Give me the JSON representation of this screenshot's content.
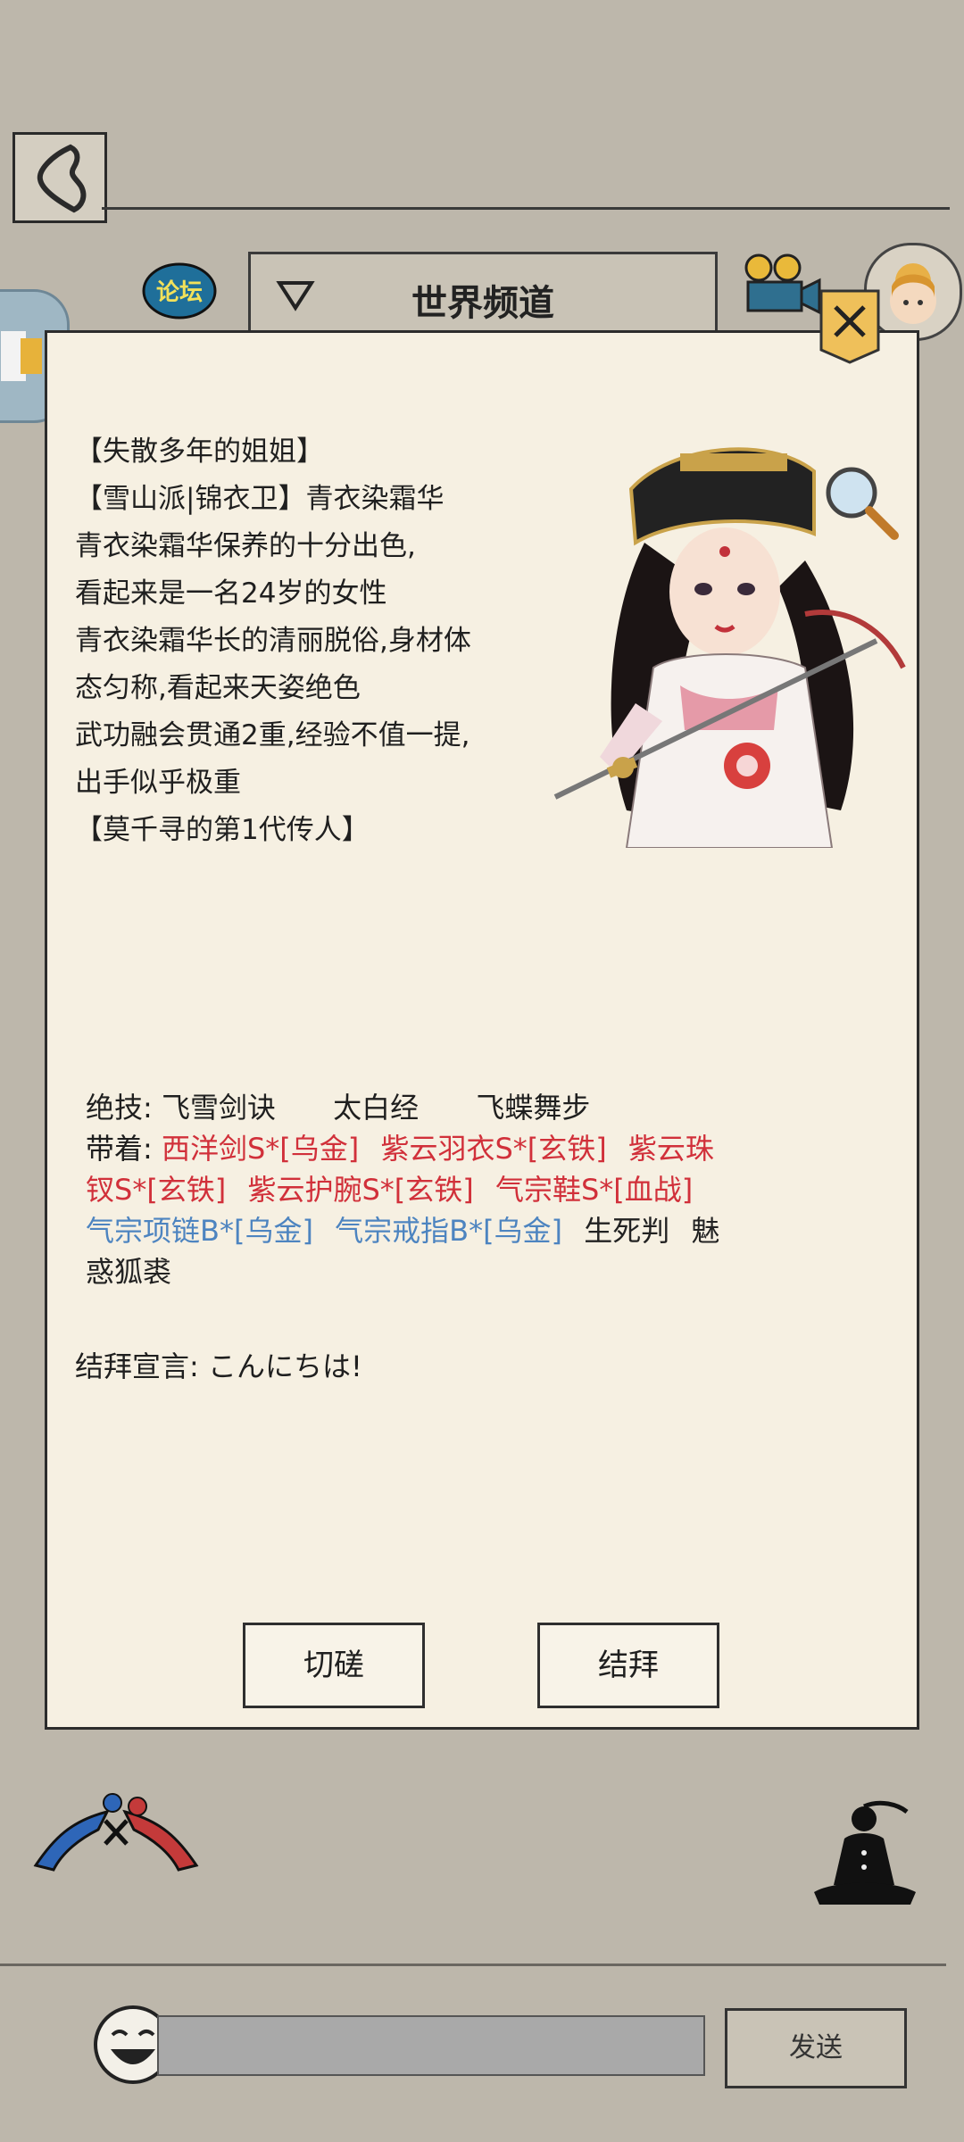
{
  "header": {
    "forum_label": "论坛",
    "channel_title": "世界频道"
  },
  "profile": {
    "bio_lines": [
      "【失散多年的姐姐】",
      "【雪山派|锦衣卫】青衣染霜华",
      "青衣染霜华保养的十分出色,",
      "看起来是一名24岁的女性",
      "青衣染霜华长的清丽脱俗,身材体",
      "态匀称,看起来天姿绝色",
      "武功融会贯通2重,经验不值一提,",
      "出手似乎极重",
      "【莫千寻的第1代传人】"
    ],
    "skills_label": "绝技:",
    "skills": [
      "飞雪剑诀",
      "太白经",
      "飞蝶舞步"
    ],
    "equip_label": "带着:",
    "equip": {
      "sword": "西洋剑S*[乌金]",
      "robe": "紫云羽衣S*[玄铁]",
      "hairpin_a": "紫云珠",
      "hairpin_b": "钗S*[玄铁]",
      "bracer": "紫云护腕S*[玄铁]",
      "shoes": "气宗鞋S*[血战]",
      "necklace": "气宗项链B*[乌金]",
      "ring": "气宗戒指B*[乌金]",
      "tag": "生死判",
      "fur_a": "魅",
      "fur_b": "惑狐裘"
    },
    "declaration": "结拜宣言: こんにちは!"
  },
  "actions": {
    "spar": "切磋",
    "sworn": "结拜"
  },
  "chat": {
    "send": "发送"
  },
  "colors": {
    "background": "#bdb7ab",
    "panel": "#f6f0e2",
    "s_grade": "#d1303a",
    "b_grade": "#4d84c0",
    "close_badge": "#efc05a"
  },
  "icons": [
    "back-icon",
    "dropdown-triangle-icon",
    "camera-icon",
    "close-icon",
    "magnifier-icon",
    "pvp-icon",
    "meditate-icon",
    "laughing-face-icon"
  ]
}
